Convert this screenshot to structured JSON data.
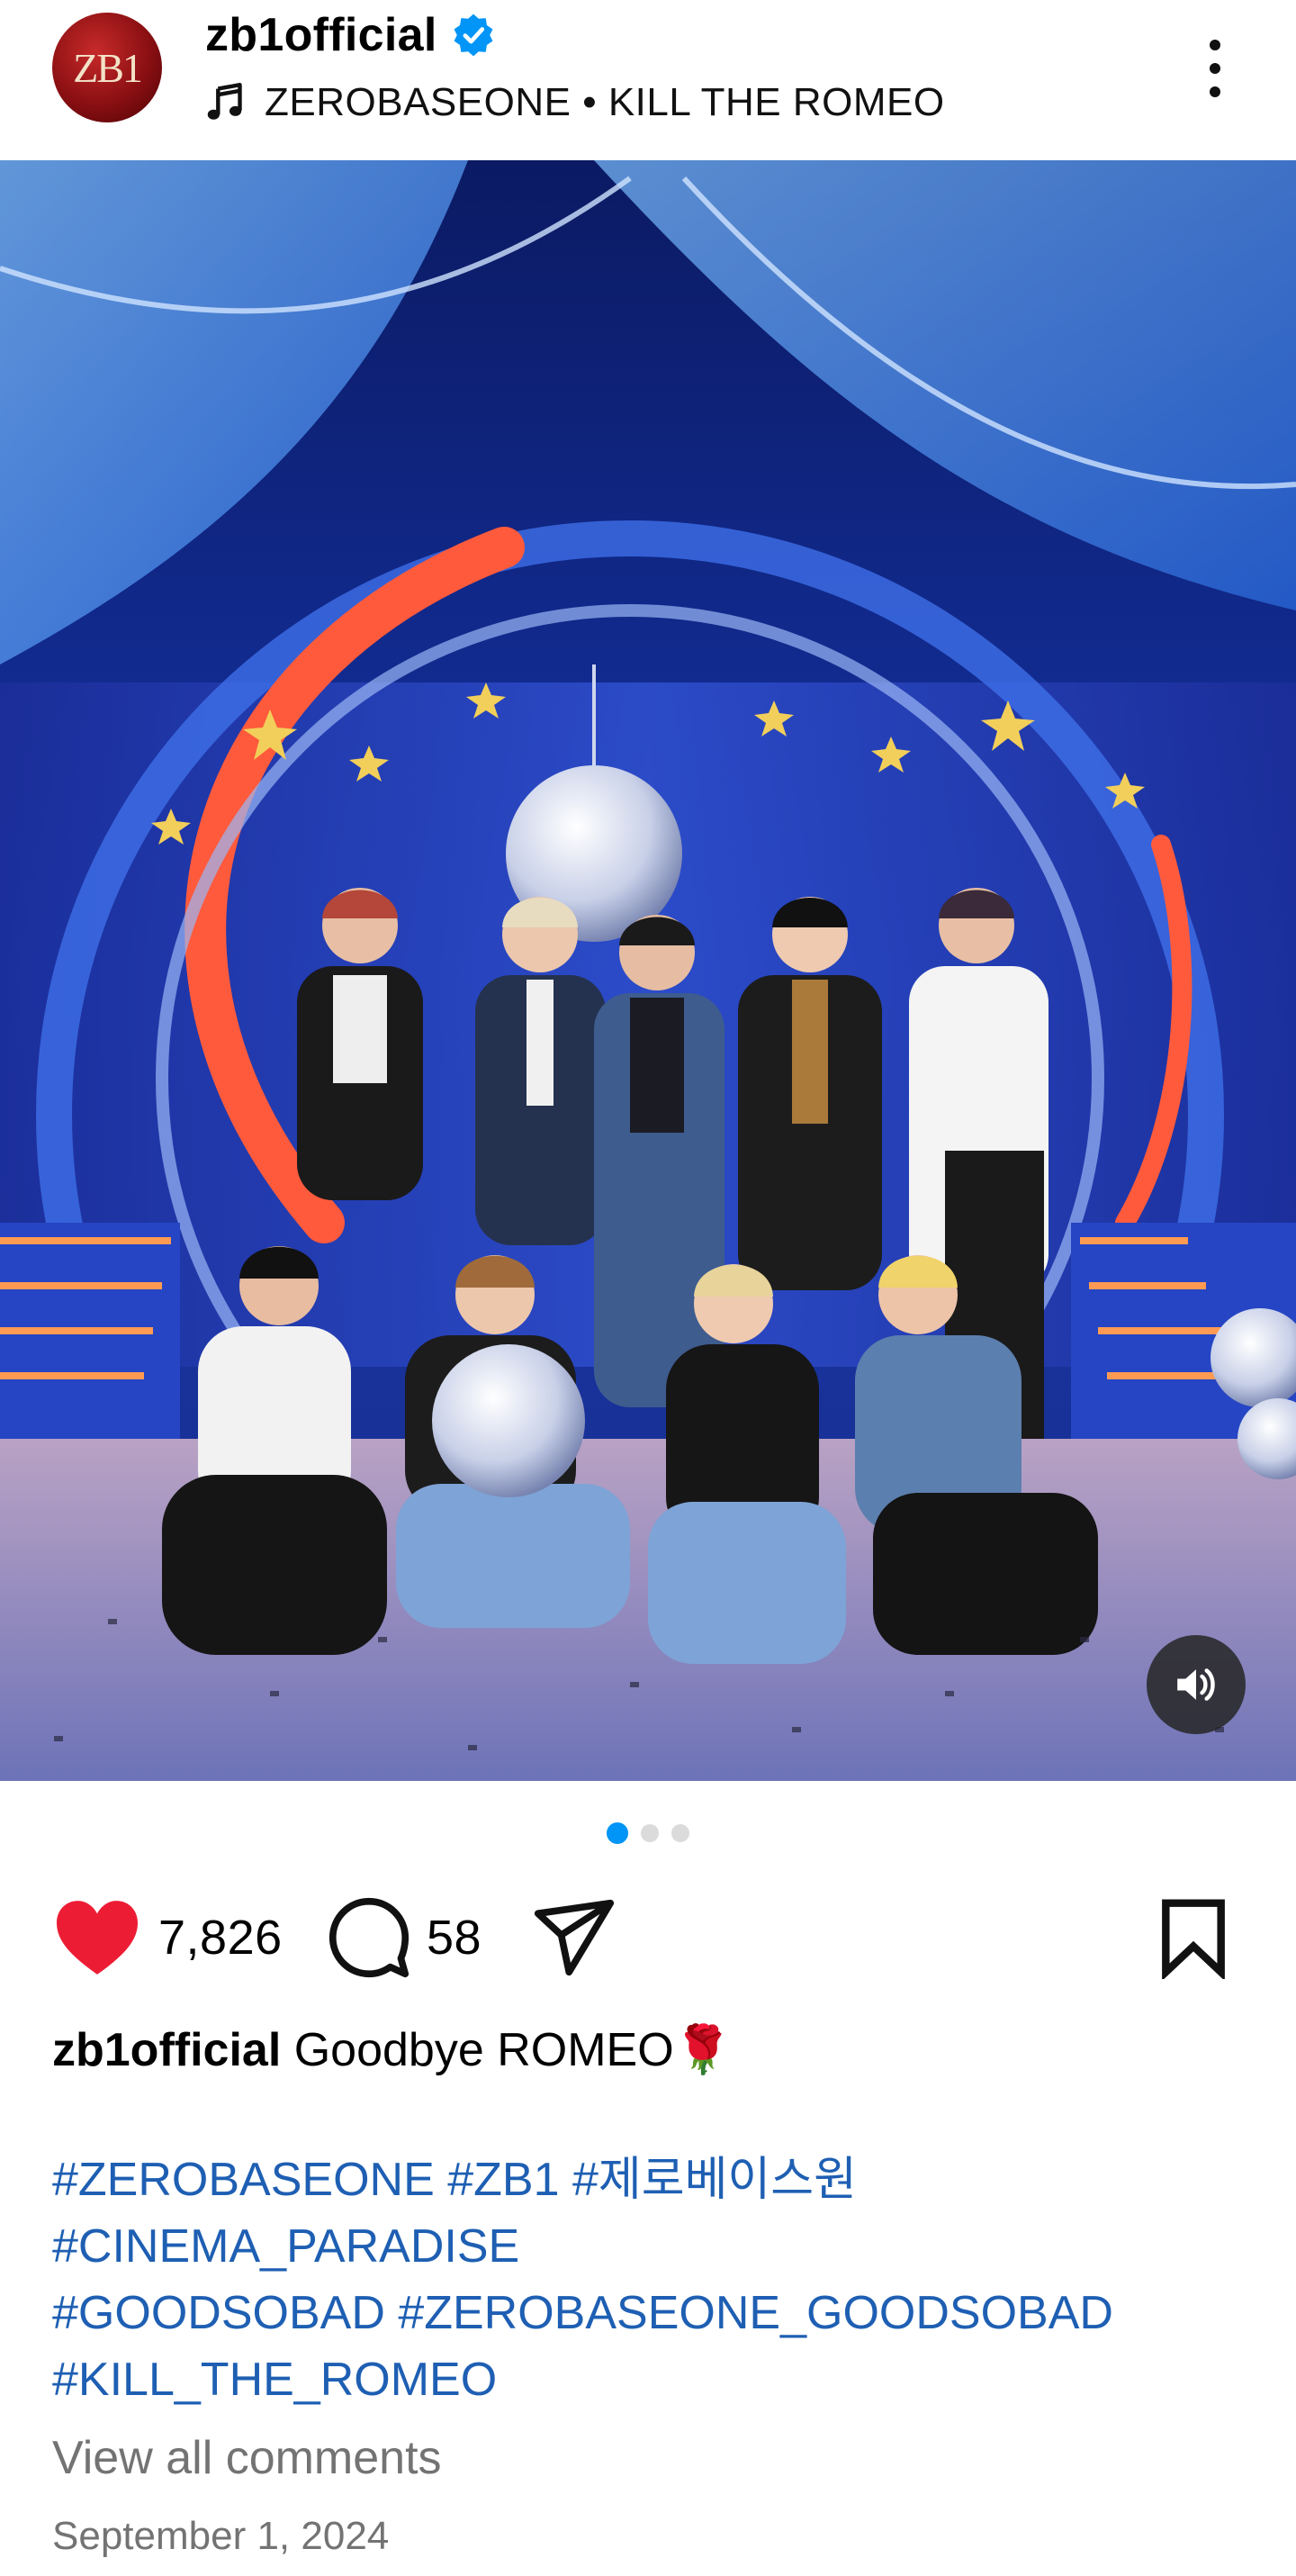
{
  "post": {
    "username": "zb1official",
    "avatar_text": "ZB1",
    "verified": true,
    "music": "ZEROBASEONE • KILL THE ROMEO",
    "likes": "7,826",
    "comments": "58",
    "caption": {
      "username": "zb1official",
      "text": "Goodbye ROMEO🌹"
    },
    "hashtag_lines": [
      "#ZEROBASEONE #ZB1 #제로베이스원",
      "#CINEMA_PARADISE",
      "#GOODSOBAD #ZEROBASEONE_GOODSOBAD",
      "#KILL_THE_ROMEO"
    ],
    "view_comments": "View all comments",
    "date": "September 1, 2024",
    "carousel": {
      "count": 3,
      "current": 1
    }
  },
  "icons": {
    "verified": "verified-badge-icon",
    "music": "music-note-icon",
    "more": "more-vertical-icon",
    "sound": "volume-icon",
    "like": "heart-icon",
    "comment": "comment-icon",
    "share": "send-icon",
    "save": "bookmark-icon"
  },
  "colors": {
    "like": "#ed1c35",
    "hashtag": "#1e5fb3",
    "verified": "#0095f6",
    "carousel_active": "#0095f6",
    "muted_text": "#737373"
  }
}
